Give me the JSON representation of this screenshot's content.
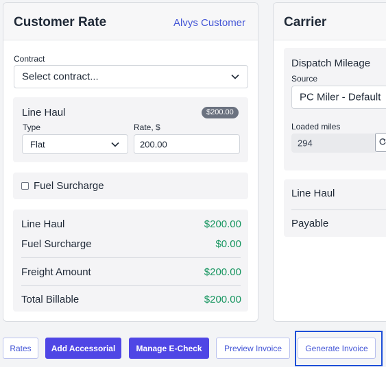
{
  "customer_rate": {
    "title": "Customer Rate",
    "customer_link": "Alvys Customer",
    "contract_label": "Contract",
    "contract_placeholder": "Select contract...",
    "line_haul": {
      "title": "Line Haul",
      "badge": "$200.00",
      "type_label": "Type",
      "type_value": "Flat",
      "rate_label": "Rate, $",
      "rate_value": "200.00"
    },
    "fuel_surcharge_label": "Fuel Surcharge",
    "fuel_surcharge_checked": false,
    "summary": [
      {
        "label": "Line Haul",
        "value": "$200.00"
      },
      {
        "label": "Fuel Surcharge",
        "value": "$0.00"
      },
      {
        "label": "Freight Amount",
        "value": "$200.00"
      },
      {
        "label": "Total Billable",
        "value": "$200.00"
      }
    ]
  },
  "carrier": {
    "title": "Carrier",
    "dispatch_title": "Dispatch Mileage",
    "source_label": "Source",
    "source_value": "PC Miler - Default",
    "loaded_miles_label": "Loaded miles",
    "loaded_miles_value": "294",
    "line_haul_label": "Line Haul",
    "payable_label": "Payable"
  },
  "actions": {
    "rates": "Rates",
    "add_accessorial": "Add Accessorial",
    "manage_echeck": "Manage E-Check",
    "preview_invoice": "Preview Invoice",
    "generate_invoice": "Generate Invoice"
  },
  "colors": {
    "accent": "#4f46e5",
    "link": "#4355d6",
    "positive": "#16955f",
    "focus": "#1d4fd8"
  }
}
